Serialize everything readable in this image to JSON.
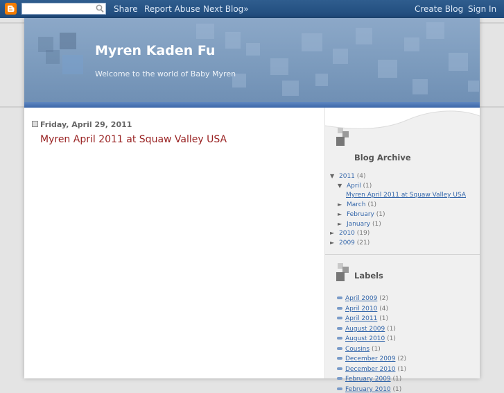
{
  "navbar": {
    "search_value": "",
    "share": "Share",
    "report_abuse": "Report Abuse",
    "next_blog": "Next Blog»",
    "create_blog": "Create Blog",
    "sign_in": "Sign In",
    "logo_color": "#f57d00"
  },
  "header": {
    "title": "Myren Kaden Fu",
    "tagline": "Welcome to the world of Baby Myren"
  },
  "post": {
    "date": "Friday, April 29, 2011",
    "title": "Myren April 2011 at Squaw Valley USA"
  },
  "sidebar": {
    "archive_title": "Blog Archive",
    "archive": [
      {
        "tri": "▼",
        "label": "2011",
        "count": "(4)"
      },
      {
        "tri": "▼",
        "label": "April",
        "count": "(1)"
      },
      {
        "tri": "",
        "label": "Myren April 2011 at Squaw Valley USA",
        "count": ""
      },
      {
        "tri": "►",
        "label": "March",
        "count": "(1)"
      },
      {
        "tri": "►",
        "label": "February",
        "count": "(1)"
      },
      {
        "tri": "►",
        "label": "January",
        "count": "(1)"
      },
      {
        "tri": "►",
        "label": "2010",
        "count": "(19)"
      },
      {
        "tri": "►",
        "label": "2009",
        "count": "(21)"
      }
    ],
    "labels_title": "Labels",
    "labels": [
      {
        "label": "April 2009",
        "count": "(2)"
      },
      {
        "label": "April 2010",
        "count": "(4)"
      },
      {
        "label": "April 2011",
        "count": "(1)"
      },
      {
        "label": "August 2009",
        "count": "(1)"
      },
      {
        "label": "August 2010",
        "count": "(1)"
      },
      {
        "label": "Cousins",
        "count": "(1)"
      },
      {
        "label": "December 2009",
        "count": "(2)"
      },
      {
        "label": "December 2010",
        "count": "(1)"
      },
      {
        "label": "February 2009",
        "count": "(1)"
      },
      {
        "label": "February 2010",
        "count": "(1)"
      }
    ]
  }
}
